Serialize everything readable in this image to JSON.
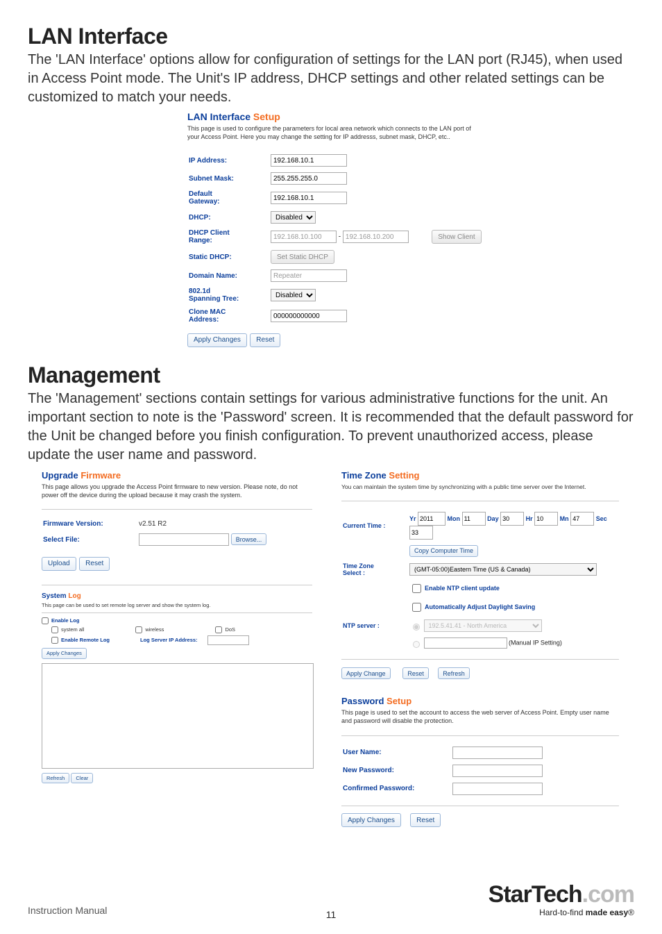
{
  "section1": {
    "heading": "LAN Interface",
    "intro": "The 'LAN Interface' options allow for configuration of settings for the LAN port (RJ45), when used in Access Point mode.  The Unit's IP address, DHCP settings and other related settings can be customized to match your needs."
  },
  "lan_panel": {
    "title_a": "LAN Interface",
    "title_b": " Setup",
    "desc": "This page is used to configure the parameters for local area network which connects to the LAN port of your Access Point. Here you may change the setting for IP addresss, subnet mask, DHCP, etc..",
    "rows": {
      "ip_label": "IP Address:",
      "ip_value": "192.168.10.1",
      "subnet_label": "Subnet Mask:",
      "subnet_value": "255.255.255.0",
      "gateway_label_a": "Default",
      "gateway_label_b": "Gateway:",
      "gateway_value": "192.168.10.1",
      "dhcp_label": "DHCP:",
      "dhcp_value": "Disabled",
      "range_label_a": "DHCP Client",
      "range_label_b": "Range:",
      "range_from": "192.168.10.100",
      "range_to": "192.168.10.200",
      "show_client": "Show Client",
      "static_label": "Static DHCP:",
      "static_btn": "Set Static DHCP",
      "domain_label": "Domain Name:",
      "domain_value": "Repeater",
      "span_label_a": "802.1d",
      "span_label_b": "Spanning Tree:",
      "span_value": "Disabled",
      "clone_label_a": "Clone MAC",
      "clone_label_b": "Address:",
      "clone_value": "000000000000",
      "apply": "Apply Changes",
      "reset": "Reset"
    }
  },
  "section2": {
    "heading": "Management",
    "intro": "The 'Management' sections contain settings for various administrative functions for the unit.  An important section to note is the 'Password' screen. It is recommended that the default password for the Unit be changed before you finish configuration.  To prevent unauthorized access, please update the user name and password."
  },
  "upgrade": {
    "title_a": "Upgrade ",
    "title_b": "Firmware",
    "desc": "This page allows you upgrade the Access Point firmware to new version. Please note, do not power off the device during the upload because it may crash the system.",
    "fw_label": "Firmware Version:",
    "fw_value": "v2.51 R2",
    "file_label": "Select File:",
    "browse": "Browse...",
    "upload": "Upload",
    "reset": "Reset"
  },
  "syslog": {
    "title_a": "System ",
    "title_b": "Log",
    "desc": "This page can be used to set remote log server and show the system log.",
    "enable_log": "Enable Log",
    "system_all": "system all",
    "wireless": "wireless",
    "dos": "DoS",
    "enable_remote": "Enable Remote Log",
    "log_server": "Log Server IP Address:",
    "apply": "Apply Changes",
    "refresh": "Refresh",
    "clear": "Clear"
  },
  "tz": {
    "title_a": "Time Zone",
    "title_b": " Setting",
    "desc": "You can maintain the system time by synchronizing with a public time server over the Internet.",
    "current_label": "Current Time :",
    "yr": "Yr",
    "yr_v": "2011",
    "mon": "Mon",
    "mon_v": "11",
    "day": "Day",
    "day_v": "30",
    "hr": "Hr",
    "hr_v": "10",
    "mn": "Mn",
    "mn_v": "47",
    "sec": "Sec",
    "sec_v": "33",
    "copy": "Copy Computer Time",
    "tz_label_a": "Time Zone",
    "tz_label_b": "Select :",
    "tz_value": "(GMT-05:00)Eastern Time (US & Canada)",
    "enable_ntp": "Enable NTP client update",
    "auto_dst": "Automatically Adjust Daylight Saving",
    "ntp_label": "NTP server :",
    "ntp_value": "192.5.41.41 - North America",
    "manual_ip": "(Manual IP Setting)",
    "apply": "Apply Change",
    "reset": "Reset",
    "refresh": "Refresh"
  },
  "pwd": {
    "title_a": "Password",
    "title_b": " Setup",
    "desc": "This page is used to set the account to access the web server of Access Point. Empty user name and password will disable the protection.",
    "user_label": "User Name:",
    "new_pwd_label": "New Password:",
    "confirm_label": "Confirmed Password:",
    "apply": "Apply Changes",
    "reset": "Reset"
  },
  "footer": {
    "manual": "Instruction Manual",
    "page_num": "11",
    "logo_a": "StarTech",
    "logo_b": ".com",
    "tagline_a": "Hard-to-find ",
    "tagline_b": "made easy",
    "tagline_c": "®"
  }
}
